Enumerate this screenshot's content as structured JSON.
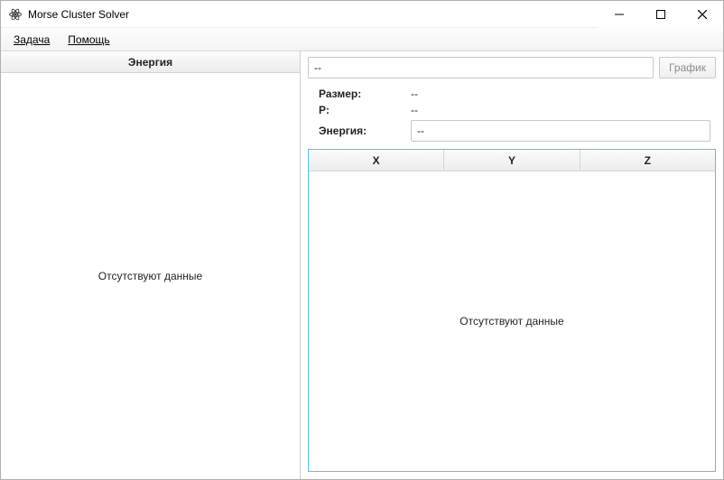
{
  "window": {
    "title": "Morse Cluster Solver"
  },
  "menu": {
    "task": "Задача",
    "help": "Помощь"
  },
  "left": {
    "header": "Энергия",
    "empty": "Отсутствуют данные"
  },
  "top": {
    "path_value": "--",
    "graph_btn": "График"
  },
  "info": {
    "size_label": "Размер:",
    "size_value": "--",
    "p_label": "P:",
    "p_value": "--",
    "energy_label": "Энергия:",
    "energy_value": "--"
  },
  "grid": {
    "cols": {
      "x": "X",
      "y": "Y",
      "z": "Z"
    },
    "empty": "Отсутствуют данные"
  }
}
